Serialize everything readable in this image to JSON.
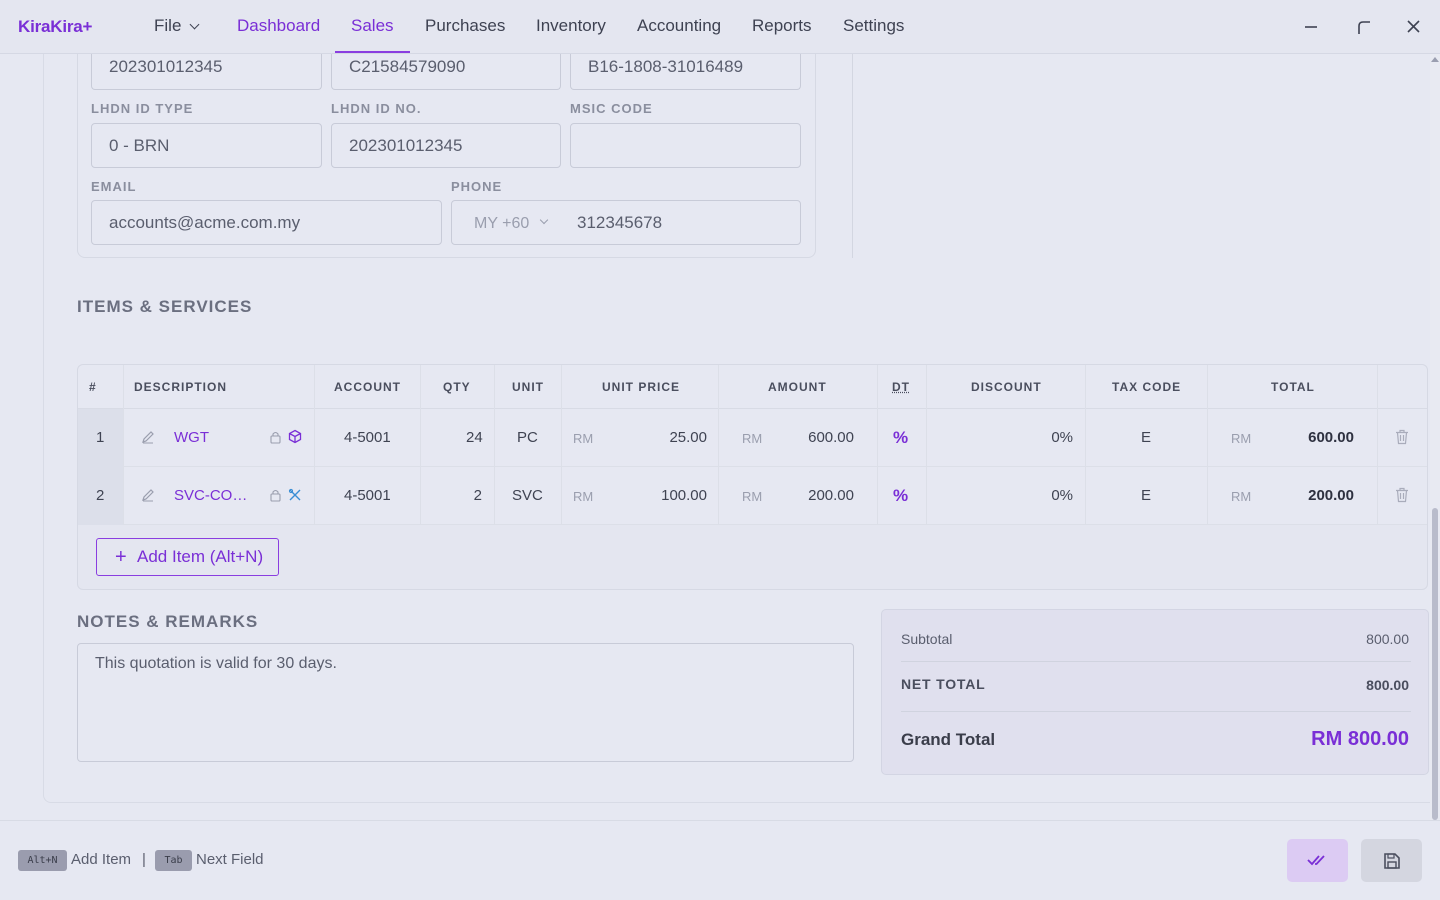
{
  "app": {
    "logo": "KiraKira+"
  },
  "menu": {
    "file": "File",
    "items": [
      "Dashboard",
      "Sales",
      "Purchases",
      "Inventory",
      "Accounting",
      "Reports",
      "Settings"
    ],
    "active": "Sales"
  },
  "customer": {
    "reg_no": "202301012345",
    "tin": "C21584579090",
    "sst": "B16-1808-31016489",
    "lhdn_id_type_label": "LHDN ID TYPE",
    "lhdn_id_type": "0 - BRN",
    "lhdn_id_no_label": "LHDN ID NO.",
    "lhdn_id_no": "202301012345",
    "msic_label": "MSIC CODE",
    "msic": "",
    "email_label": "EMAIL",
    "email": "accounts@acme.com.my",
    "phone_label": "PHONE",
    "phone_country": "MY +60",
    "phone": "312345678"
  },
  "items_section": {
    "title": "ITEMS & SERVICES",
    "headers": {
      "num": "#",
      "description": "DESCRIPTION",
      "account": "ACCOUNT",
      "qty": "QTY",
      "unit": "UNIT",
      "unit_price": "UNIT PRICE",
      "amount": "AMOUNT",
      "dt": "DT",
      "discount": "DISCOUNT",
      "tax_code": "TAX CODE",
      "total": "TOTAL"
    },
    "currency": "RM",
    "rows": [
      {
        "num": "1",
        "description": "WGT",
        "account": "4-5001",
        "qty": "24",
        "unit": "PC",
        "unit_price": "25.00",
        "amount": "600.00",
        "dt": "%",
        "discount": "0%",
        "tax_code": "E",
        "total": "600.00",
        "type_icon": "package-icon"
      },
      {
        "num": "2",
        "description": "SVC-CO…",
        "account": "4-5001",
        "qty": "2",
        "unit": "SVC",
        "unit_price": "100.00",
        "amount": "200.00",
        "dt": "%",
        "discount": "0%",
        "tax_code": "E",
        "total": "200.00",
        "type_icon": "service-tools-icon"
      }
    ],
    "add_item": "Add Item (Alt+N)"
  },
  "notes": {
    "title": "NOTES & REMARKS",
    "text": "This quotation is valid for 30 days."
  },
  "totals": {
    "subtotal_label": "Subtotal",
    "subtotal": "800.00",
    "net_total_label": "NET TOTAL",
    "net_total": "800.00",
    "grand_total_label": "Grand Total",
    "grand_total": "RM 800.00"
  },
  "footer": {
    "shortcut1_key": "Alt+N",
    "shortcut1_label": "Add Item",
    "separator": "|",
    "shortcut2_key": "Tab",
    "shortcut2_label": "Next Field"
  },
  "colors": {
    "accent": "#7a2fd6",
    "background": "#e6e8f2"
  }
}
